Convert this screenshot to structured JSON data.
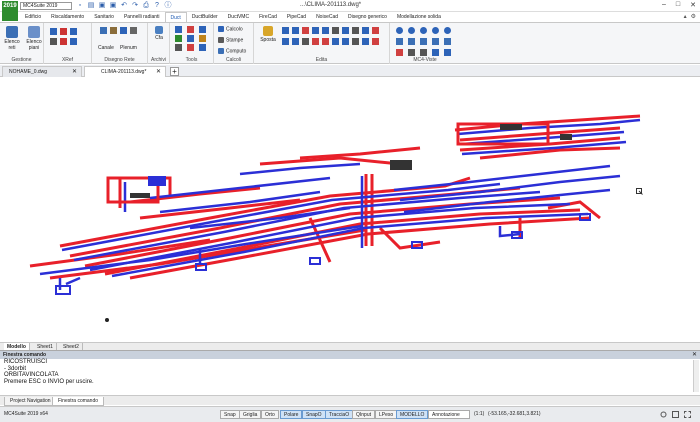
{
  "app": {
    "logo_text": "2019",
    "selector": "MC4Suite 2019",
    "window_title": "...\\CLIMA-201113.dwg*",
    "controls": [
      "–",
      "□",
      "✕"
    ]
  },
  "ribbon_tabs": [
    "Edificio",
    "Riscaldamento",
    "Sanitario",
    "Pannelli radianti",
    "Duct",
    "DuctBuilder",
    "DuctVMC",
    "FireCad",
    "PipeCad",
    "NoiseCad",
    "Disegno generico",
    "Modellazione solida"
  ],
  "active_ribbon_tab": "Duct",
  "ribbon": {
    "gestione": {
      "label": "Gestione",
      "btn1": "Elenco reti",
      "btn2": "Elenco piani"
    },
    "xref": {
      "label": "XRef"
    },
    "disegno_rete": {
      "label": "Disegno Rete",
      "btn1": "Canale",
      "btn2": "Plenum"
    },
    "archivi": {
      "label": "Archivi",
      "btn1": "Cfa"
    },
    "tools": {
      "label": "Tools"
    },
    "calcoli": {
      "label": "Calcoli",
      "btn1": "Calcolo",
      "btn2": "Stampe",
      "btn3": "Computo"
    },
    "edita": {
      "label": "Edita",
      "btn1": "Sposta"
    },
    "mc4_viste": {
      "label": "MC4-Viste"
    }
  },
  "doc_tabs": [
    {
      "label": "NOHAME_0.dwg",
      "close": "✕"
    },
    {
      "label": "CLIMA-201113.dwg*",
      "close": "✕"
    }
  ],
  "add_tab": "+",
  "layout_tabs": [
    "Modello",
    "Sheet1",
    "Sheet2"
  ],
  "command": {
    "header": "Finestra comando",
    "close": "✕",
    "lines": [
      "RICOSTRUISCI",
      "- 3dorbit",
      "ORBITAVINCOLATA",
      "Premere ESC o INVIO per uscire."
    ]
  },
  "panel_tabs": [
    "Project Navigation",
    "Finestra comando"
  ],
  "status": {
    "app_version": "MC4Suite 2019 x64",
    "toggles": [
      {
        "label": "Snap",
        "on": false
      },
      {
        "label": "Griglia",
        "on": false
      },
      {
        "label": "Orto",
        "on": false
      },
      {
        "label": "Polare",
        "on": true
      },
      {
        "label": "SnapO",
        "on": true
      },
      {
        "label": "TracciaO",
        "on": true
      },
      {
        "label": "QInput",
        "on": false
      },
      {
        "label": "LPeso",
        "on": false
      },
      {
        "label": "MODELLO",
        "on": true
      }
    ],
    "annotation": "Annotazione",
    "scale": "(1:1)",
    "coords": "(-53.165,-32.681,3.821)"
  },
  "colors": {
    "supply": "#e8202a",
    "return": "#2b2fd6",
    "accent": "#1a57b0"
  }
}
